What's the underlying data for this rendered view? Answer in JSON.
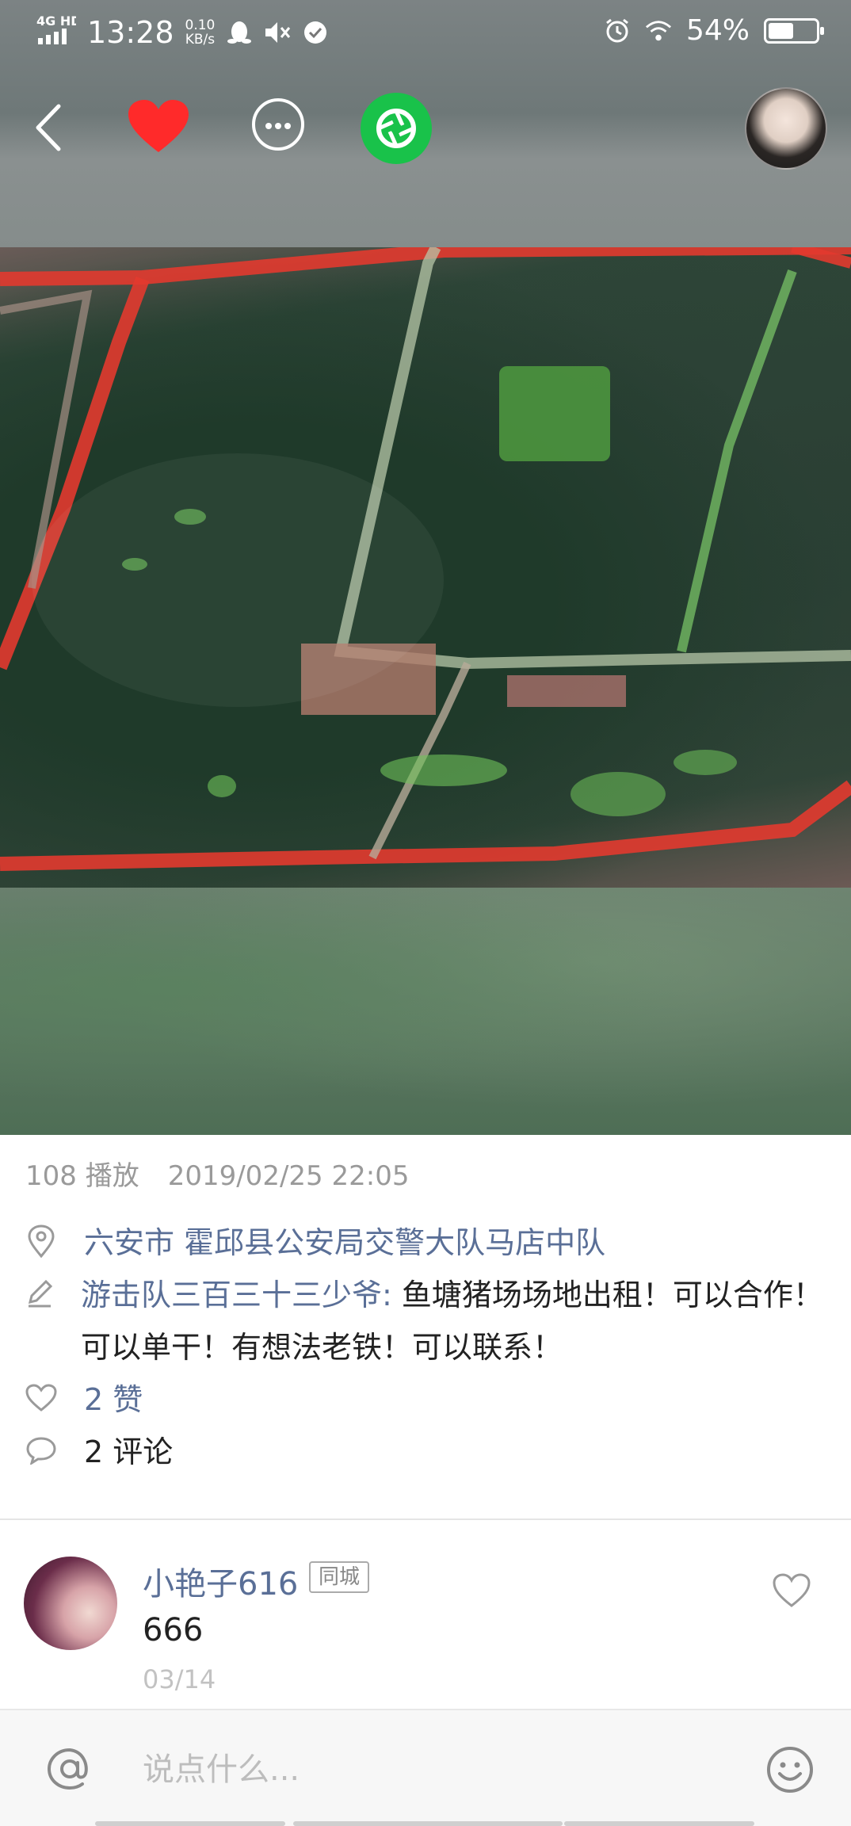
{
  "status_bar": {
    "network": "4G HD",
    "time": "13:28",
    "speed_value": "0.10",
    "speed_unit": "KB/s",
    "battery": "54%",
    "battery_level": 0.54,
    "icons": [
      "signal-icon",
      "qq-penguin-icon",
      "mute-icon",
      "check-circle-icon",
      "alarm-icon",
      "wifi-icon",
      "battery-icon"
    ]
  },
  "header": {
    "icons": [
      "back-arrow-icon",
      "heart-icon",
      "more-icon",
      "moments-shutter-icon",
      "avatar"
    ],
    "colors": {
      "heart": "#ff2a2a",
      "moments": "#19c24a"
    }
  },
  "post": {
    "plays": "108 播放",
    "datetime": "2019/02/25 22:05",
    "location": "六安市 霍邱县公安局交警大队马店中队",
    "author": "游击队三百三十三少爷:",
    "text": "鱼塘猪场场地出租！可以合作！可以单干！有想法老铁！可以联系！",
    "likes": "2 赞",
    "comments": "2 评论"
  },
  "comment": {
    "name": "小艳子616",
    "badge": "同城",
    "text": "666",
    "date": "03/14"
  },
  "input": {
    "placeholder": "说点什么..."
  },
  "colors": {
    "link": "#5a6f97",
    "secondary_text": "#9a9a9a",
    "divider": "#e5e5e5"
  }
}
